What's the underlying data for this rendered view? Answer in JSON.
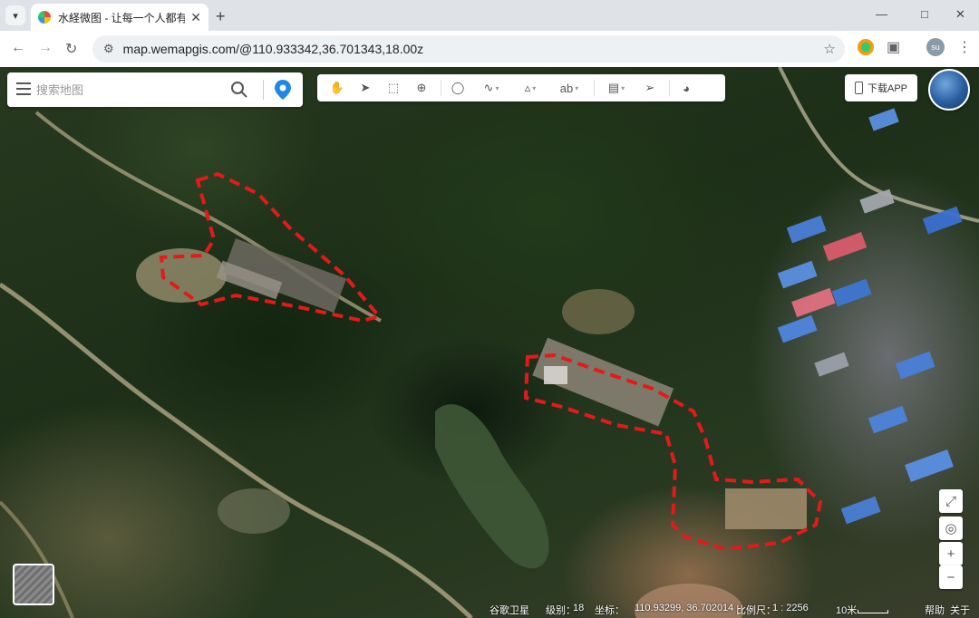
{
  "browser": {
    "tab_title": "水経微图 - 让每一个人都有自己",
    "url": "map.wemapgis.com/@110.933342,36.701343,18.00z",
    "profile_initials": "su"
  },
  "map": {
    "search_placeholder": "搜索地图",
    "download_label": "下载APP",
    "tools": [
      "pan-hand",
      "select-arrow",
      "box-select",
      "zoom-area",
      "marker",
      "polyline",
      "polygon",
      "text-label",
      "measure-ruler",
      "pointer-settings",
      "web-globe"
    ],
    "status": {
      "source": "谷歌卫星",
      "level_label": "级别：",
      "level_value": "18",
      "coord_label": "坐标：",
      "coord_value": "110.93299, 36.702014",
      "scale_label": "比例尺：",
      "scale_value": "1 : 2256",
      "scale_bar_label": "10米",
      "help": "帮助",
      "about": "关于"
    }
  },
  "colors": {
    "outline": "#e11b1b",
    "pin": "#1e88e5"
  }
}
